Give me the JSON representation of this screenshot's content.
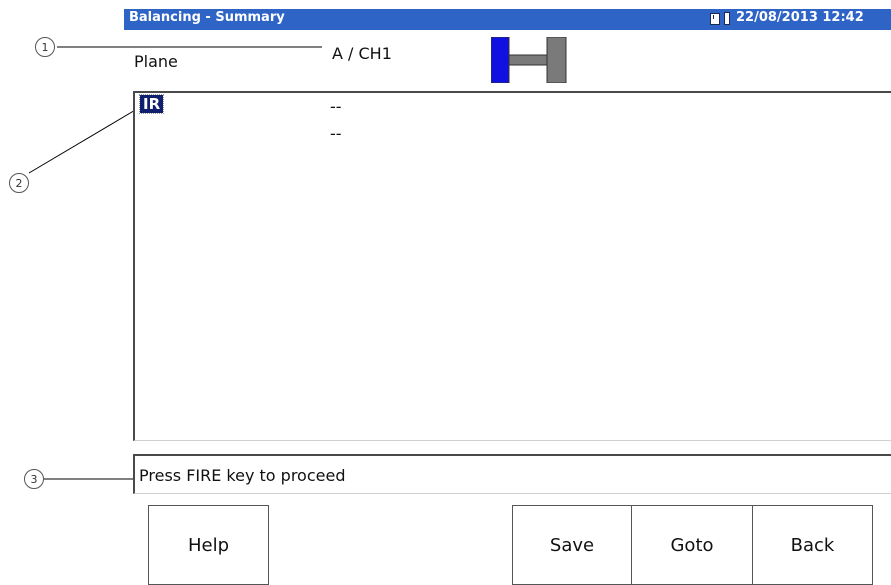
{
  "titlebar": {
    "title": "Balancing - Summary",
    "datetime": "22/08/2013 12:42",
    "sd_icon": "sd-card-icon",
    "battery_icon": "battery-icon",
    "color": "#2f64c7"
  },
  "plane": {
    "label": "Plane",
    "value": "A / CH1",
    "diagram_icon": "rotor-plane-diagram-icon",
    "active_plane_color": "#1010e0",
    "inactive_plane_color": "#7a7a7a"
  },
  "results": [
    {
      "name": "IR",
      "value": "--",
      "selected": true
    },
    {
      "name": "",
      "value": "--",
      "selected": false
    }
  ],
  "status": {
    "message": "Press FIRE key to proceed"
  },
  "softkeys": {
    "help": "Help",
    "save": "Save",
    "goto": "Goto",
    "back": "Back"
  },
  "callouts": [
    "1",
    "2",
    "3"
  ]
}
